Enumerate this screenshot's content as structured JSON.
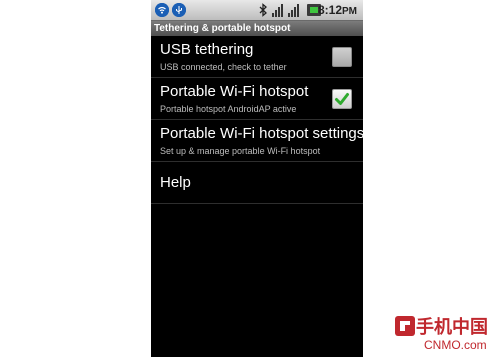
{
  "status_bar": {
    "time": "8:12",
    "time_suffix": "PM",
    "icons": [
      "wifi-hotspot-notification-icon",
      "usb-notification-icon",
      "bluetooth-icon",
      "signal-icon",
      "signal-icon",
      "battery-icon"
    ]
  },
  "title_bar": {
    "title": "Tethering & portable hotspot"
  },
  "settings": {
    "items": [
      {
        "label": "USB tethering",
        "summary": "USB connected, check to tether",
        "checked": false,
        "enabled": false
      },
      {
        "label": "Portable Wi-Fi hotspot",
        "summary": "Portable hotspot AndroidAP active",
        "checked": true,
        "enabled": true
      },
      {
        "label": "Portable Wi-Fi hotspot settings",
        "summary": "Set up & manage portable Wi-Fi hotspot"
      },
      {
        "label": "Help"
      }
    ]
  },
  "colors": {
    "background": "#000000",
    "title_bar": "#5e5e5e",
    "check_green": "#2faa2f",
    "watermark_red": "#c0282e"
  },
  "watermark": {
    "cn": "手机中国",
    "en": "CNMO.com"
  }
}
